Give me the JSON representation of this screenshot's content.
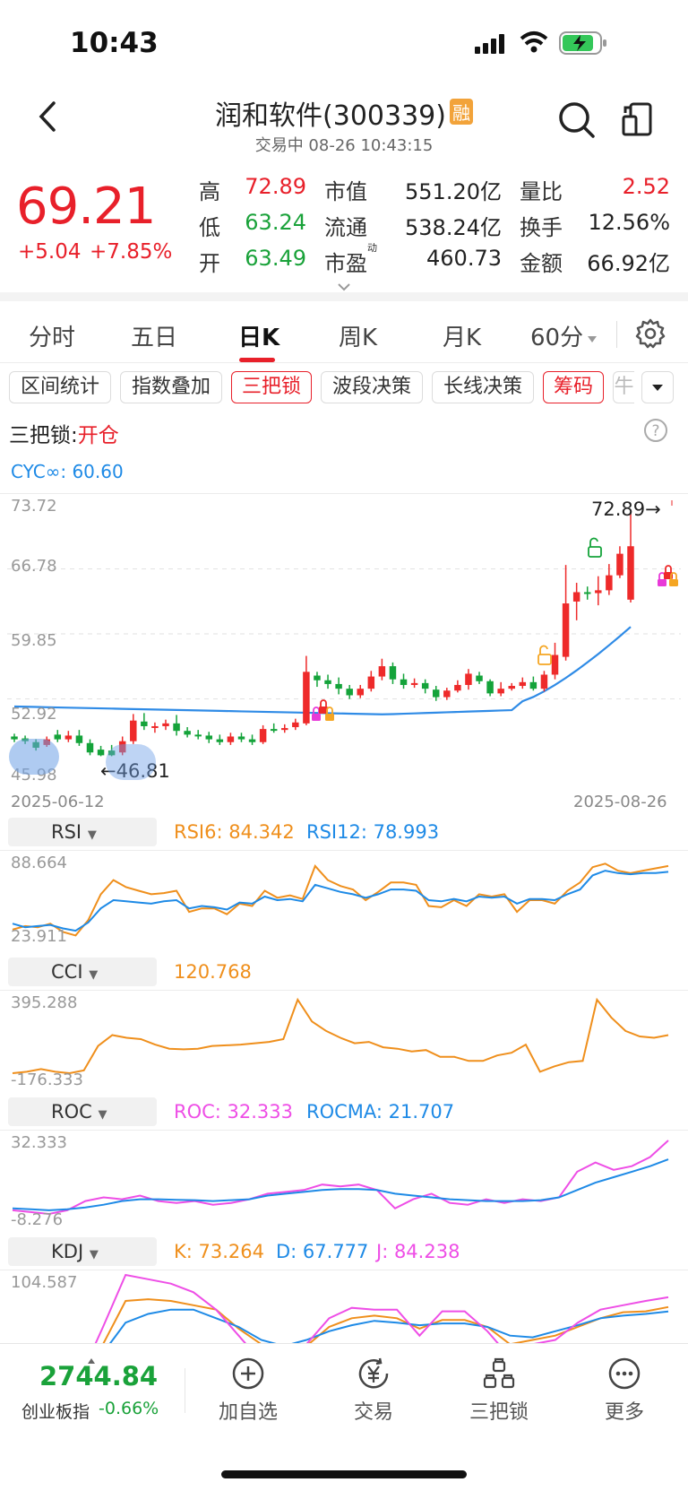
{
  "status": {
    "time": "10:43"
  },
  "header": {
    "title": "润和软件(300339)",
    "badge": "融",
    "subtitle": "交易中 08-26 10:43:15"
  },
  "quote": {
    "price": "69.21",
    "change": "+5.04",
    "change_pct": "+7.85%",
    "rows": [
      {
        "l1": "高",
        "v1": "72.89",
        "l2": "市值",
        "v2": "551.20亿",
        "l3": "量比",
        "v3": "2.52"
      },
      {
        "l1": "低",
        "v1": "63.24",
        "l2": "流通",
        "v2": "538.24亿",
        "l3": "换手",
        "v3": "12.56%"
      },
      {
        "l1": "开",
        "v1": "63.49",
        "l2": "市盈",
        "v2": "460.73",
        "l3": "金额",
        "v3": "66.92亿"
      }
    ],
    "pe_sup": "动"
  },
  "tabs": [
    "分时",
    "五日",
    "日K",
    "周K",
    "月K",
    "60分"
  ],
  "chips": [
    "区间统计",
    "指数叠加",
    "三把锁",
    "波段决策",
    "长线决策",
    "筹码",
    "牛"
  ],
  "lock": {
    "label": "三把锁:",
    "status": "开仓"
  },
  "cyc": "CYC∞: 60.60",
  "chart_data": [
    {
      "type": "candlestick",
      "y_labels": [
        "73.72",
        "66.78",
        "59.85",
        "52.92",
        "45.98"
      ],
      "dates": [
        "2025-06-12",
        "2025-08-26"
      ],
      "high_label": "72.89→",
      "low_label": "←46.81",
      "ma_label": "CYC∞: 60.60",
      "candles": [
        [
          48.9,
          48.6,
          49.2,
          48.3
        ],
        [
          48.7,
          48.4,
          49.0,
          48.1
        ],
        [
          48.3,
          47.7,
          48.6,
          47.4
        ],
        [
          48.0,
          48.6,
          48.9,
          47.8
        ],
        [
          49.1,
          48.6,
          49.6,
          48.3
        ],
        [
          48.6,
          49.0,
          49.5,
          48.3
        ],
        [
          49.0,
          48.2,
          49.6,
          47.9
        ],
        [
          48.2,
          47.2,
          48.6,
          46.9
        ],
        [
          47.5,
          46.9,
          47.9,
          46.8
        ],
        [
          47.4,
          46.9,
          48.0,
          46.8
        ],
        [
          47.2,
          48.4,
          48.9,
          46.9
        ],
        [
          48.4,
          50.6,
          51.3,
          48.1
        ],
        [
          50.5,
          50.0,
          51.4,
          49.6
        ],
        [
          49.9,
          50.0,
          50.4,
          49.3
        ],
        [
          50.0,
          50.3,
          50.7,
          49.6
        ],
        [
          50.3,
          49.5,
          51.2,
          49.0
        ],
        [
          49.5,
          49.1,
          49.9,
          48.8
        ],
        [
          49.1,
          49.0,
          49.6,
          48.6
        ],
        [
          49.0,
          48.6,
          49.4,
          48.2
        ],
        [
          48.6,
          48.3,
          49.1,
          48.0
        ],
        [
          48.3,
          48.9,
          49.3,
          48.0
        ],
        [
          48.9,
          48.6,
          49.3,
          48.3
        ],
        [
          48.6,
          48.3,
          49.1,
          48.0
        ],
        [
          48.3,
          49.7,
          50.1,
          48.1
        ],
        [
          49.7,
          49.6,
          50.3,
          49.3
        ],
        [
          49.6,
          49.8,
          50.2,
          49.3
        ],
        [
          49.9,
          50.4,
          50.8,
          49.6
        ],
        [
          50.3,
          55.8,
          57.5,
          50.1
        ],
        [
          55.4,
          54.9,
          55.8,
          54.2
        ],
        [
          54.9,
          54.5,
          55.5,
          54.0
        ],
        [
          54.5,
          54.0,
          55.2,
          53.4
        ],
        [
          54.0,
          53.3,
          54.4,
          52.9
        ],
        [
          53.3,
          54.0,
          54.4,
          53.0
        ],
        [
          54.0,
          55.3,
          55.9,
          53.7
        ],
        [
          55.3,
          56.4,
          57.2,
          54.9
        ],
        [
          56.4,
          55.0,
          56.8,
          54.5
        ],
        [
          55.0,
          54.4,
          55.6,
          54.0
        ],
        [
          54.4,
          54.6,
          55.1,
          54.1
        ],
        [
          54.6,
          54.0,
          55.0,
          53.5
        ],
        [
          53.9,
          53.1,
          54.3,
          52.7
        ],
        [
          53.1,
          53.8,
          54.1,
          52.8
        ],
        [
          53.8,
          54.4,
          54.9,
          53.6
        ],
        [
          54.4,
          55.6,
          56.1,
          53.9
        ],
        [
          55.4,
          54.8,
          55.8,
          54.5
        ],
        [
          54.8,
          53.5,
          55.0,
          53.2
        ],
        [
          53.5,
          54.0,
          54.7,
          53.2
        ],
        [
          54.0,
          54.3,
          54.6,
          53.8
        ],
        [
          54.3,
          54.7,
          55.2,
          54.0
        ],
        [
          54.7,
          54.0,
          55.3,
          53.8
        ],
        [
          54.0,
          55.5,
          55.9,
          53.7
        ],
        [
          55.5,
          57.6,
          58.9,
          55.0
        ],
        [
          57.4,
          63.1,
          67.2,
          57.0
        ],
        [
          63.3,
          64.3,
          65.3,
          61.3
        ],
        [
          64.3,
          64.2,
          64.9,
          63.5
        ],
        [
          64.2,
          64.5,
          66.0,
          62.9
        ],
        [
          64.5,
          66.1,
          67.3,
          64.0
        ],
        [
          66.1,
          68.4,
          69.2,
          65.8
        ],
        [
          63.5,
          69.2,
          72.9,
          63.2
        ]
      ]
    },
    {
      "type": "line",
      "panel": "RSI",
      "y_labels": [
        "88.664",
        "23.911"
      ],
      "series": [
        {
          "name": "RSI6",
          "value_label": "RSI6: 84.342",
          "color": "#ef8f1c",
          "values": [
            30,
            33,
            32,
            35,
            28,
            25,
            38,
            60,
            72,
            66,
            63,
            60,
            61,
            63,
            45,
            48,
            48,
            43,
            52,
            50,
            63,
            57,
            59,
            56,
            84,
            72,
            67,
            64,
            55,
            62,
            70,
            70,
            68,
            50,
            49,
            55,
            50,
            60,
            58,
            60,
            45,
            55,
            55,
            52,
            63,
            70,
            83,
            86,
            80,
            78,
            80,
            82,
            84
          ]
        },
        {
          "name": "RSI12",
          "value_label": "RSI12: 78.993",
          "color": "#1e8ae6",
          "values": [
            35,
            32,
            33,
            34,
            31,
            29,
            36,
            48,
            55,
            54,
            53,
            52,
            54,
            55,
            48,
            50,
            49,
            47,
            53,
            52,
            58,
            55,
            56,
            54,
            68,
            65,
            62,
            60,
            57,
            60,
            64,
            64,
            63,
            55,
            54,
            56,
            54,
            58,
            57,
            58,
            52,
            56,
            56,
            55,
            60,
            64,
            76,
            80,
            78,
            77,
            78,
            78,
            79
          ]
        }
      ]
    },
    {
      "type": "line",
      "panel": "CCI",
      "y_labels": [
        "395.288",
        "-176.333"
      ],
      "series": [
        {
          "name": "CCI",
          "value_label": "120.768",
          "color": "#ef8f1c",
          "values": [
            -160,
            -150,
            -130,
            -150,
            -160,
            -140,
            40,
            120,
            100,
            90,
            50,
            20,
            15,
            20,
            40,
            45,
            50,
            60,
            70,
            90,
            380,
            220,
            150,
            100,
            60,
            70,
            30,
            20,
            0,
            10,
            -40,
            -40,
            -70,
            -70,
            -30,
            -10,
            50,
            -150,
            -110,
            -80,
            -70,
            380,
            250,
            150,
            110,
            100,
            120
          ]
        }
      ]
    },
    {
      "type": "line",
      "panel": "ROC",
      "y_labels": [
        "32.333",
        "-8.276"
      ],
      "series": [
        {
          "name": "ROC",
          "value_label": "ROC: 32.333",
          "color": "#ee4ee6",
          "values": [
            -6,
            -7,
            -8,
            -6,
            -1,
            1,
            0,
            2,
            -1,
            -2,
            -1,
            -3,
            -2,
            0,
            3,
            4,
            5,
            8,
            7,
            8,
            5,
            -5,
            0,
            3,
            -2,
            -3,
            0,
            -2,
            0,
            -1,
            1,
            15,
            20,
            16,
            18,
            23,
            32
          ]
        },
        {
          "name": "ROCMA",
          "value_label": "ROCMA: 21.707",
          "color": "#1e8ae6",
          "values": [
            -5,
            -5.5,
            -6,
            -5.5,
            -4.5,
            -3,
            -1,
            0,
            0,
            -0.3,
            -0.5,
            -1,
            -0.5,
            0,
            2,
            3,
            4,
            5,
            5.5,
            5.5,
            5,
            3,
            2,
            1,
            0,
            -0.5,
            -1,
            -1,
            -1,
            -0.5,
            1,
            5,
            9,
            12,
            15,
            18,
            21.7
          ]
        }
      ]
    },
    {
      "type": "line",
      "panel": "KDJ",
      "y_labels": [
        "104.587"
      ],
      "series": [
        {
          "name": "K",
          "value_label": "K: 73.264",
          "color": "#ef8f1c",
          "values": [
            22,
            10,
            5,
            3,
            30,
            80,
            82,
            80,
            75,
            70,
            48,
            30,
            20,
            28,
            50,
            60,
            63,
            60,
            48,
            58,
            58,
            50,
            30,
            35,
            40,
            50,
            60,
            67,
            68,
            73
          ]
        },
        {
          "name": "D",
          "value_label": "D: 67.777",
          "color": "#1e8ae6",
          "values": [
            30,
            20,
            12,
            8,
            20,
            55,
            65,
            70,
            70,
            60,
            50,
            35,
            28,
            35,
            45,
            52,
            57,
            55,
            52,
            54,
            54,
            50,
            40,
            38,
            45,
            52,
            60,
            63,
            65,
            67.8
          ]
        },
        {
          "name": "J",
          "value_label": "J: 84.238",
          "color": "#ee4ee6",
          "values": [
            15,
            -5,
            -10,
            -8,
            50,
            110,
            105,
            100,
            90,
            70,
            40,
            10,
            5,
            30,
            60,
            72,
            70,
            70,
            40,
            68,
            68,
            45,
            15,
            30,
            35,
            55,
            70,
            75,
            80,
            84.2
          ]
        }
      ]
    }
  ],
  "panels": {
    "rsi": {
      "name": "RSI"
    },
    "cci": {
      "name": "CCI"
    },
    "roc": {
      "name": "ROC"
    },
    "kdj": {
      "name": "KDJ"
    }
  },
  "bottom": {
    "index_value": "2744.84",
    "index_name": "创业板指",
    "index_change": "-0.66%",
    "nav": [
      {
        "label": "加自选",
        "icon": "add-icon"
      },
      {
        "label": "交易",
        "icon": "yen-icon"
      },
      {
        "label": "三把锁",
        "icon": "lock-tree-icon"
      },
      {
        "label": "更多",
        "icon": "more-icon"
      }
    ]
  }
}
